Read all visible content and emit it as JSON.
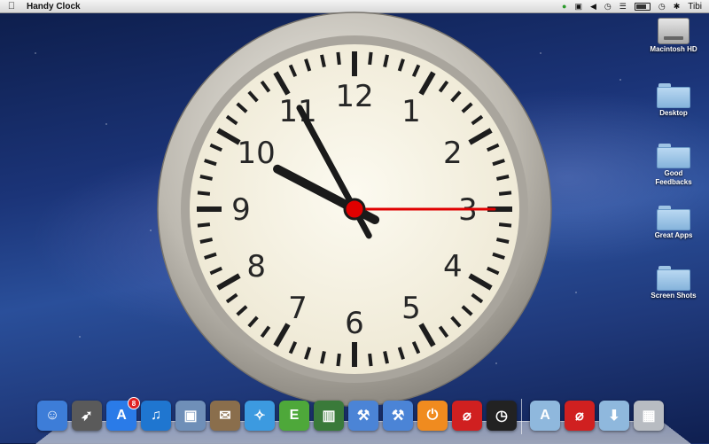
{
  "menubar": {
    "apple_icon": "apple-icon",
    "app_name": "Handy Clock",
    "status_icons": [
      "evernote-elephant-icon",
      "monitor-icon",
      "volume-icon",
      "timemachine-icon",
      "wifi-icon",
      "battery-icon",
      "clock-icon",
      "bluetooth-icon"
    ],
    "user": "Tibi"
  },
  "desktop_icons": [
    {
      "label": "Macintosh HD",
      "icon": "harddisk-icon"
    },
    {
      "label": "Desktop",
      "icon": "folder-icon"
    },
    {
      "label": "Good Feedbacks",
      "icon": "folder-icon"
    },
    {
      "label": "Great Apps",
      "icon": "folder-icon"
    },
    {
      "label": "Screen Shots",
      "icon": "folder-icon"
    }
  ],
  "clock": {
    "numerals": [
      "12",
      "1",
      "2",
      "3",
      "4",
      "5",
      "6",
      "7",
      "8",
      "9",
      "10",
      "11"
    ],
    "time": {
      "hours": 9,
      "minutes": 55,
      "seconds": 15
    },
    "colors": {
      "face": "#f8f4e6",
      "hands": "#1a1a1a",
      "second_hand": "#e00000",
      "bezel": "#c9c5bd"
    }
  },
  "dock": {
    "items": [
      {
        "name": "finder",
        "icon": "finder-icon",
        "color": "#3d7dd8"
      },
      {
        "name": "launchpad",
        "icon": "rocket-icon",
        "color": "#5a5a5a"
      },
      {
        "name": "app-store",
        "icon": "appstore-icon",
        "color": "#2a7be8",
        "badge": "8"
      },
      {
        "name": "itunes",
        "icon": "music-note-icon",
        "color": "#1f76d0"
      },
      {
        "name": "preview",
        "icon": "photos-icon",
        "color": "#6f8fb8"
      },
      {
        "name": "mail",
        "icon": "stamp-icon",
        "color": "#8a6e4c"
      },
      {
        "name": "safari",
        "icon": "compass-icon",
        "color": "#3c9ae0"
      },
      {
        "name": "evernote",
        "icon": "elephant-icon",
        "color": "#4ea83a"
      },
      {
        "name": "activity-monitor",
        "icon": "chart-icon",
        "color": "#3a7a3a"
      },
      {
        "name": "xcode",
        "icon": "hammer-icon",
        "color": "#4b84d6"
      },
      {
        "name": "xcode-2",
        "icon": "hammer-icon",
        "color": "#4b84d6"
      },
      {
        "name": "handy-clock-app",
        "icon": "power-icon",
        "color": "#f08b1f"
      },
      {
        "name": "blocked-app",
        "icon": "no-flash-icon",
        "color": "#d02020"
      },
      {
        "name": "clock-app",
        "icon": "watch-icon",
        "color": "#222222"
      },
      {
        "name": "applications-folder",
        "icon": "apps-folder-icon",
        "color": "#8fb8dd"
      },
      {
        "name": "blocked-app-2",
        "icon": "no-flash-icon",
        "color": "#d02020"
      },
      {
        "name": "downloads-folder",
        "icon": "download-folder-icon",
        "color": "#8fb8dd"
      },
      {
        "name": "trash",
        "icon": "trash-icon",
        "color": "#b8bcc2"
      }
    ]
  }
}
